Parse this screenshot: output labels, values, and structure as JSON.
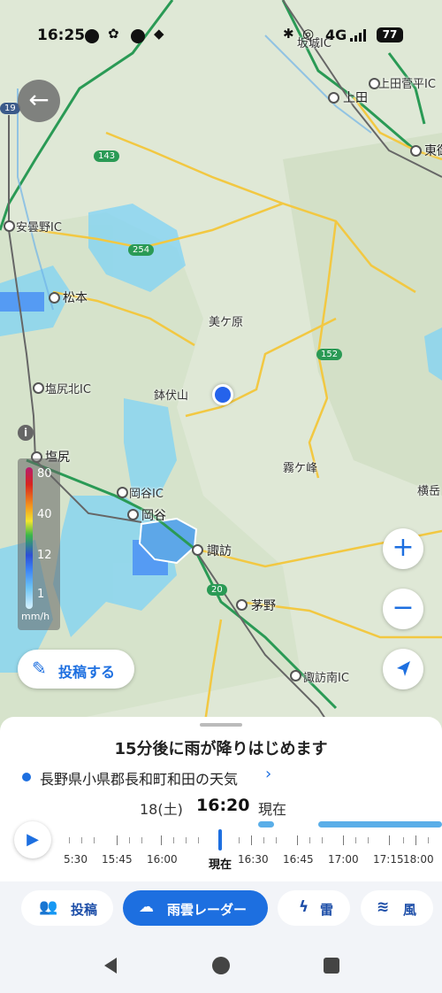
{
  "status_bar": {
    "time": "16:25",
    "network": "4G",
    "battery": "77"
  },
  "map": {
    "labels": {
      "sakaki_ic": "坂城IC",
      "ueda_sugadaira_ic": "上田菅平IC",
      "ueda": "上田",
      "tomi": "東御",
      "azumino_ic": "安曇野IC",
      "matsumoto": "松本",
      "utsukushigahara": "美ケ原",
      "shiojiri_kita_ic": "塩尻北IC",
      "hachibuseyama": "鉢伏山",
      "shiojiri": "塩尻",
      "kirigamine": "霧ケ峰",
      "yokodake": "横岳",
      "okaya_ic": "岡谷IC",
      "okaya": "岡谷",
      "suwa": "諏訪",
      "chino": "茅野",
      "suwa_minami_ic": "諏訪南IC"
    },
    "route_shields": {
      "r19": "19",
      "r143": "143",
      "r254": "254",
      "r152": "152",
      "r20": "20"
    },
    "legend": {
      "values": [
        "80",
        "40",
        "12",
        "1"
      ],
      "unit": "mm/h"
    },
    "buttons": {
      "post_label": "投稿する",
      "zoom_in": "+",
      "zoom_out": "−"
    }
  },
  "forecast": {
    "headline": "15分後に雨が降りはじめます",
    "location": "長野県小県郡長和町和田の天気",
    "date": "18(土)",
    "time": "16:20",
    "now_label": "現在"
  },
  "timeline": {
    "labels": [
      "5:30",
      "15:45",
      "16:00",
      "現在",
      "16:30",
      "16:45",
      "17:00",
      "17:15",
      "18:00"
    ]
  },
  "tabs": [
    {
      "label": "投稿",
      "icon": "people-icon"
    },
    {
      "label": "雨雲レーダー",
      "icon": "rain-cloud-icon",
      "active": true
    },
    {
      "label": "雷",
      "icon": "lightning-icon"
    },
    {
      "label": "風",
      "icon": "wind-icon"
    }
  ],
  "colors": {
    "accent": "#1d6fe0",
    "rain_light": "#7fd3f5",
    "map_bg": "#dfe8d6",
    "road_yellow": "#f2c842",
    "road_green": "#2a9a55"
  }
}
